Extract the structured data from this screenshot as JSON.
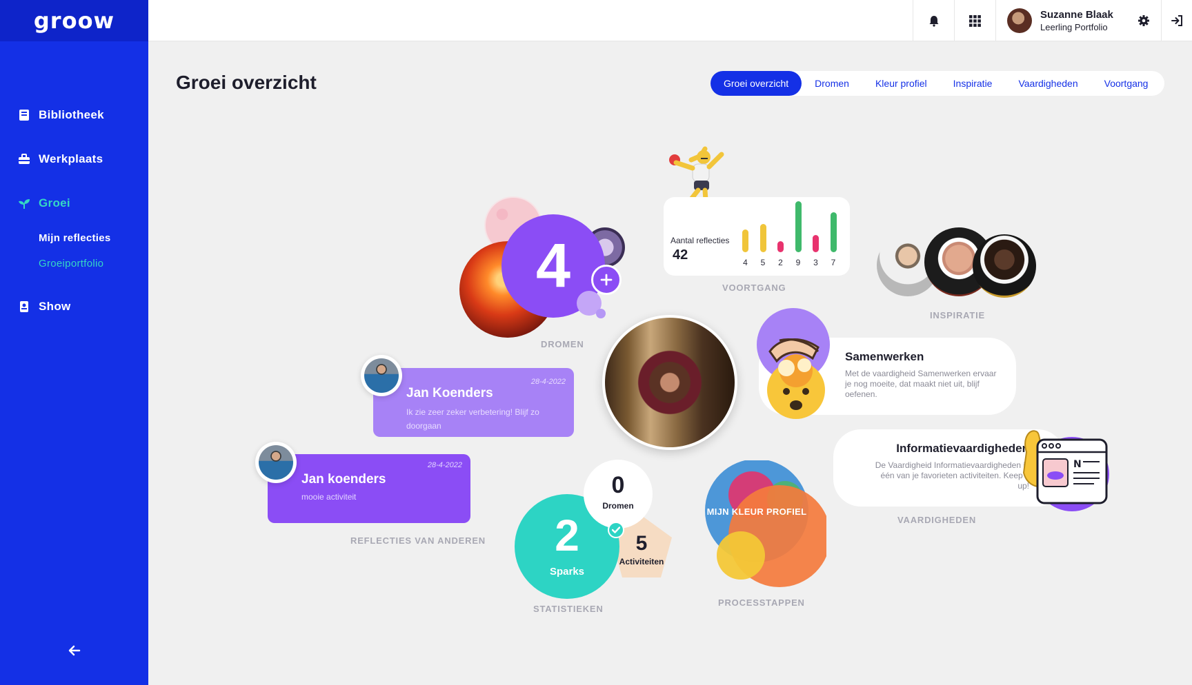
{
  "app": {
    "logo": "groow"
  },
  "sidebar": {
    "items": [
      {
        "label": "Bibliotheek",
        "icon": "book-icon"
      },
      {
        "label": "Werkplaats",
        "icon": "toolbox-icon"
      },
      {
        "label": "Groei",
        "icon": "sprout-icon"
      },
      {
        "label": "Show",
        "icon": "portfolio-icon"
      }
    ],
    "sub_items": [
      {
        "label": "Mijn reflecties"
      },
      {
        "label": "Groeiportfolio"
      }
    ],
    "collapse_icon": "arrow-left-icon"
  },
  "topbar": {
    "user_name": "Suzanne Blaak",
    "user_role": "Leerling Portfolio",
    "icons": [
      "bell-icon",
      "grid-icon",
      "gear-icon",
      "logout-icon"
    ]
  },
  "page": {
    "title": "Groei overzicht",
    "tabs": [
      "Groei overzicht",
      "Dromen",
      "Kleur profiel",
      "Inspiratie",
      "Vaardigheden",
      "Voortgang"
    ]
  },
  "dromen": {
    "count": "4",
    "label": "DROMEN"
  },
  "voortgang": {
    "title": "Aantal reflecties",
    "total": "42",
    "label": "VOORTGANG",
    "bars": [
      {
        "value": 4,
        "color": "#f0c53a"
      },
      {
        "value": 5,
        "color": "#f0c53a"
      },
      {
        "value": 2,
        "color": "#e8336e"
      },
      {
        "value": 9,
        "color": "#3fb96b"
      },
      {
        "value": 3,
        "color": "#e8336e"
      },
      {
        "value": 7,
        "color": "#3fb96b"
      }
    ]
  },
  "inspiratie": {
    "label": "INSPIRATIE"
  },
  "reflections": {
    "label": "REFLECTIES VAN ANDEREN",
    "items": [
      {
        "name": "Jan Koenders",
        "date": "28-4-2022",
        "text": "Ik zie zeer zeker verbetering! Blijf zo doorgaan"
      },
      {
        "name": "Jan koenders",
        "date": "28-4-2022",
        "text": "mooie activiteit"
      }
    ]
  },
  "skills": {
    "label": "VAARDIGHEDEN",
    "items": [
      {
        "title": "Samenwerken",
        "text": "Met de vaardigheid Samenwerken ervaar je nog moeite, dat maakt niet uit, blijf oefenen."
      },
      {
        "title": "Informatievaardigheden",
        "text": "De Vaardigheid Informatievaardigheden is één van je favorieten activiteiten. Keep it up!"
      }
    ]
  },
  "statistieken": {
    "label": "STATISTIEKEN",
    "dromen": {
      "value": "0",
      "label": "Dromen"
    },
    "sparks": {
      "value": "2",
      "label": "Sparks"
    },
    "activiteiten": {
      "value": "5",
      "label": "Activiteiten"
    }
  },
  "kleurprofiel": {
    "title": "MIJN KLEUR PROFIEL",
    "label": "PROCESSTAPPEN"
  },
  "colors": {
    "primary": "#1430e6",
    "accent": "#35d7c4",
    "purple": "#8b5cf6",
    "teal": "#2dd4c4"
  }
}
